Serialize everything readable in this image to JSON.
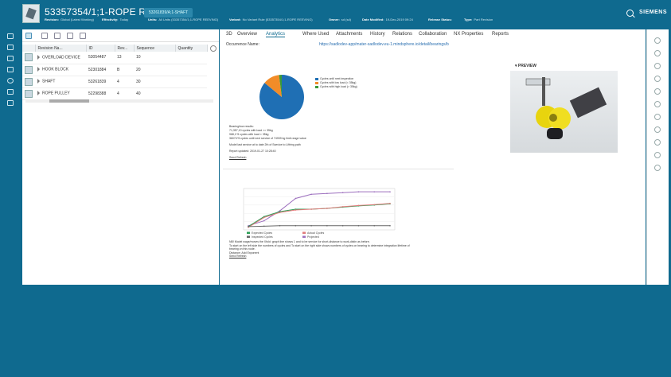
{
  "header": {
    "item_title": "53357354/1;1-ROPE REEVING",
    "crumb": "53261839/A;1-SHAFT",
    "meta": [
      {
        "label": "Revision:",
        "value": "Global (Latest Working)"
      },
      {
        "label": "Effectivity:",
        "value": "Today"
      },
      {
        "label": "Units:",
        "value": "All Units (53357354/1;1-ROPE REEVING)"
      },
      {
        "label": "Variant:",
        "value": "No Variant Rule (53357354/1;1-ROPE REEVING)"
      },
      {
        "label": "Owner:",
        "value": "sd (sd)"
      },
      {
        "label": "Date Modified:",
        "value": "19-Dec-2019 09:24"
      },
      {
        "label": "Release Status:",
        "value": ""
      },
      {
        "label": "Type:",
        "value": "Part Revision"
      }
    ],
    "brand": "SIEMENS",
    "search_icon": "search-icon"
  },
  "left_nav": {
    "icons": [
      "home-icon",
      "inbox-icon",
      "folder-icon",
      "tasks-icon",
      "favorites-icon",
      "alert-icon",
      "print-icon"
    ]
  },
  "structure_panel": {
    "columns": [
      "Revision Na...",
      "ID",
      "Rev...",
      "Sequence",
      "Quantity"
    ],
    "rows": [
      {
        "name": "OVERLOAD DEVICE",
        "id": "53054487",
        "rev": "13",
        "sequence": "10",
        "quantity": ""
      },
      {
        "name": "HOOK BLOCK",
        "id": "52301884",
        "rev": "B",
        "sequence": "20",
        "quantity": ""
      },
      {
        "name": "SHAFT",
        "id": "53261839",
        "rev": "4",
        "sequence": "30",
        "quantity": ""
      },
      {
        "name": "ROPE PULLEY",
        "id": "52298388",
        "rev": "4",
        "sequence": "40",
        "quantity": ""
      }
    ]
  },
  "tabs": [
    "3D",
    "Overview",
    "Analytics",
    "Where Used",
    "Attachments",
    "History",
    "Relations",
    "Collaboration",
    "NX Properties",
    "Reports"
  ],
  "active_tab": "Analytics",
  "occurrence": {
    "label": "Occurrence Name:",
    "link": "https://sadlodev-app/mater-sadlodev.eu-1.mindsphere.io/detail/bearings/b"
  },
  "pie_legend": [
    {
      "label": "Cycles until next inspection",
      "color": "#1f6fb4"
    },
    {
      "label": "Cycles with low load (< 35kg)",
      "color": "#f28c28"
    },
    {
      "label": "Cycles with high load (> 35kg)",
      "color": "#3a9a3a"
    }
  ],
  "analysis_text": [
    "Bearing/tow results:",
    "71,357,10 cycles with load >= 35kg",
    "968,1^5 cycles with load < 35kg",
    "36074^5 cycles until next service of 74939 kg limit range value",
    "Model last service at to date 2th of Ssevice to Liftring path",
    "Report updated: 2019-01-27 10:28:40",
    "Send Refresh"
  ],
  "notes_text": [
    "NB! Model wage/moves the Xfold: graph line shows 1 and to be service for short-distance to work-distin as before.",
    "To start on the left side the numbers of cycles and To start on the right side shows numbers of cycles on bearing to determine integration lifetime of bearing on this node.",
    "Distance:     Add Exponent",
    "Send Refresh"
  ],
  "preview": {
    "label": "PREVIEW"
  },
  "right_toolbar": {
    "icons": [
      "info-icon",
      "edit-icon",
      "share-icon",
      "copy-icon",
      "settings-icon",
      "plus-icon",
      "refresh-icon",
      "link-icon",
      "lock-icon",
      "pin-icon",
      "more-icon"
    ]
  },
  "chart_data": [
    {
      "type": "pie",
      "labels": [
        "Cycles until next inspection",
        "Cycles with low load (< 35kg)",
        "Cycles with high load (> 35kg)"
      ],
      "values": [
        86,
        12,
        2
      ],
      "colors": [
        "#1f6fb4",
        "#f28c28",
        "#3a9a3a"
      ],
      "title": ""
    },
    {
      "type": "line",
      "x": [
        1,
        2,
        3,
        4,
        5,
        6,
        7,
        8,
        9,
        10
      ],
      "series": [
        {
          "values": [
            0.5,
            1.1,
            2.3,
            3.8,
            4.3,
            4.4,
            4.5,
            4.6,
            4.6,
            4.6
          ],
          "color": "#9c6fbe"
        },
        {
          "values": [
            0.4,
            1.6,
            2.2,
            2.5,
            2.5,
            2.6,
            2.75,
            2.9,
            3.0,
            3.15
          ],
          "color": "#2c9e56"
        },
        {
          "values": [
            0.3,
            1.5,
            2.1,
            2.4,
            2.5,
            2.6,
            2.8,
            2.95,
            3.05,
            3.2
          ],
          "color": "#e07a7a"
        },
        {
          "values": [
            0.4,
            0.45,
            0.5,
            0.5,
            0.5,
            0.5,
            0.5,
            0.5,
            0.5,
            0.5
          ],
          "color": "#666666"
        }
      ],
      "ylim": [
        0,
        5
      ],
      "legend": [
        {
          "label": "Expected Cycles",
          "color": "#2c9e56"
        },
        {
          "label": "Actual Cycles",
          "color": "#e07a7a"
        },
        {
          "label": "Inspected Cycles",
          "color": "#666666"
        },
        {
          "label": "Projected",
          "color": "#9c6fbe"
        }
      ],
      "title": "",
      "xlabel": "",
      "ylabel": ""
    }
  ]
}
